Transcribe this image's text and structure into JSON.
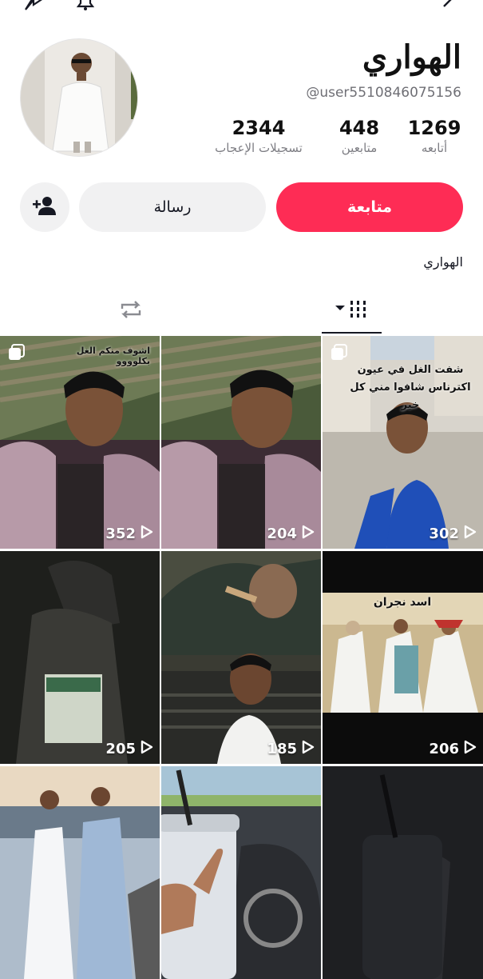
{
  "profile": {
    "display_name": "الهواري",
    "handle": "@user5510846075156",
    "bio": "الهواري",
    "stats": [
      {
        "value": "1269",
        "label": "أتابعه"
      },
      {
        "value": "448",
        "label": "متابعين"
      },
      {
        "value": "2344",
        "label": "تسجيلات الإعجاب"
      }
    ]
  },
  "actions": {
    "follow_label": "متابعة",
    "message_label": "رسالة"
  },
  "colors": {
    "accent": "#fe2c55",
    "button_gray": "#f1f1f2",
    "text": "#161823"
  },
  "icons": [
    "share-icon",
    "bell-icon",
    "more-icon",
    "add-friend-icon",
    "grid-icon",
    "repost-icon",
    "play-icon",
    "multi-photo-icon"
  ],
  "videos": [
    {
      "views": "352",
      "caption": "اشوف منكم الغل بكلوووو"
    },
    {
      "views": "204",
      "caption": ""
    },
    {
      "views": "302",
      "caption": "شفت الغل في عيون اكترناس شافوا مني كل خير"
    },
    {
      "views": "205",
      "caption": ""
    },
    {
      "views": "185",
      "caption": ""
    },
    {
      "views": "206",
      "caption": "اسد نجران"
    },
    {
      "views": "",
      "caption": ""
    },
    {
      "views": "",
      "caption": ""
    },
    {
      "views": "",
      "caption": ""
    }
  ]
}
